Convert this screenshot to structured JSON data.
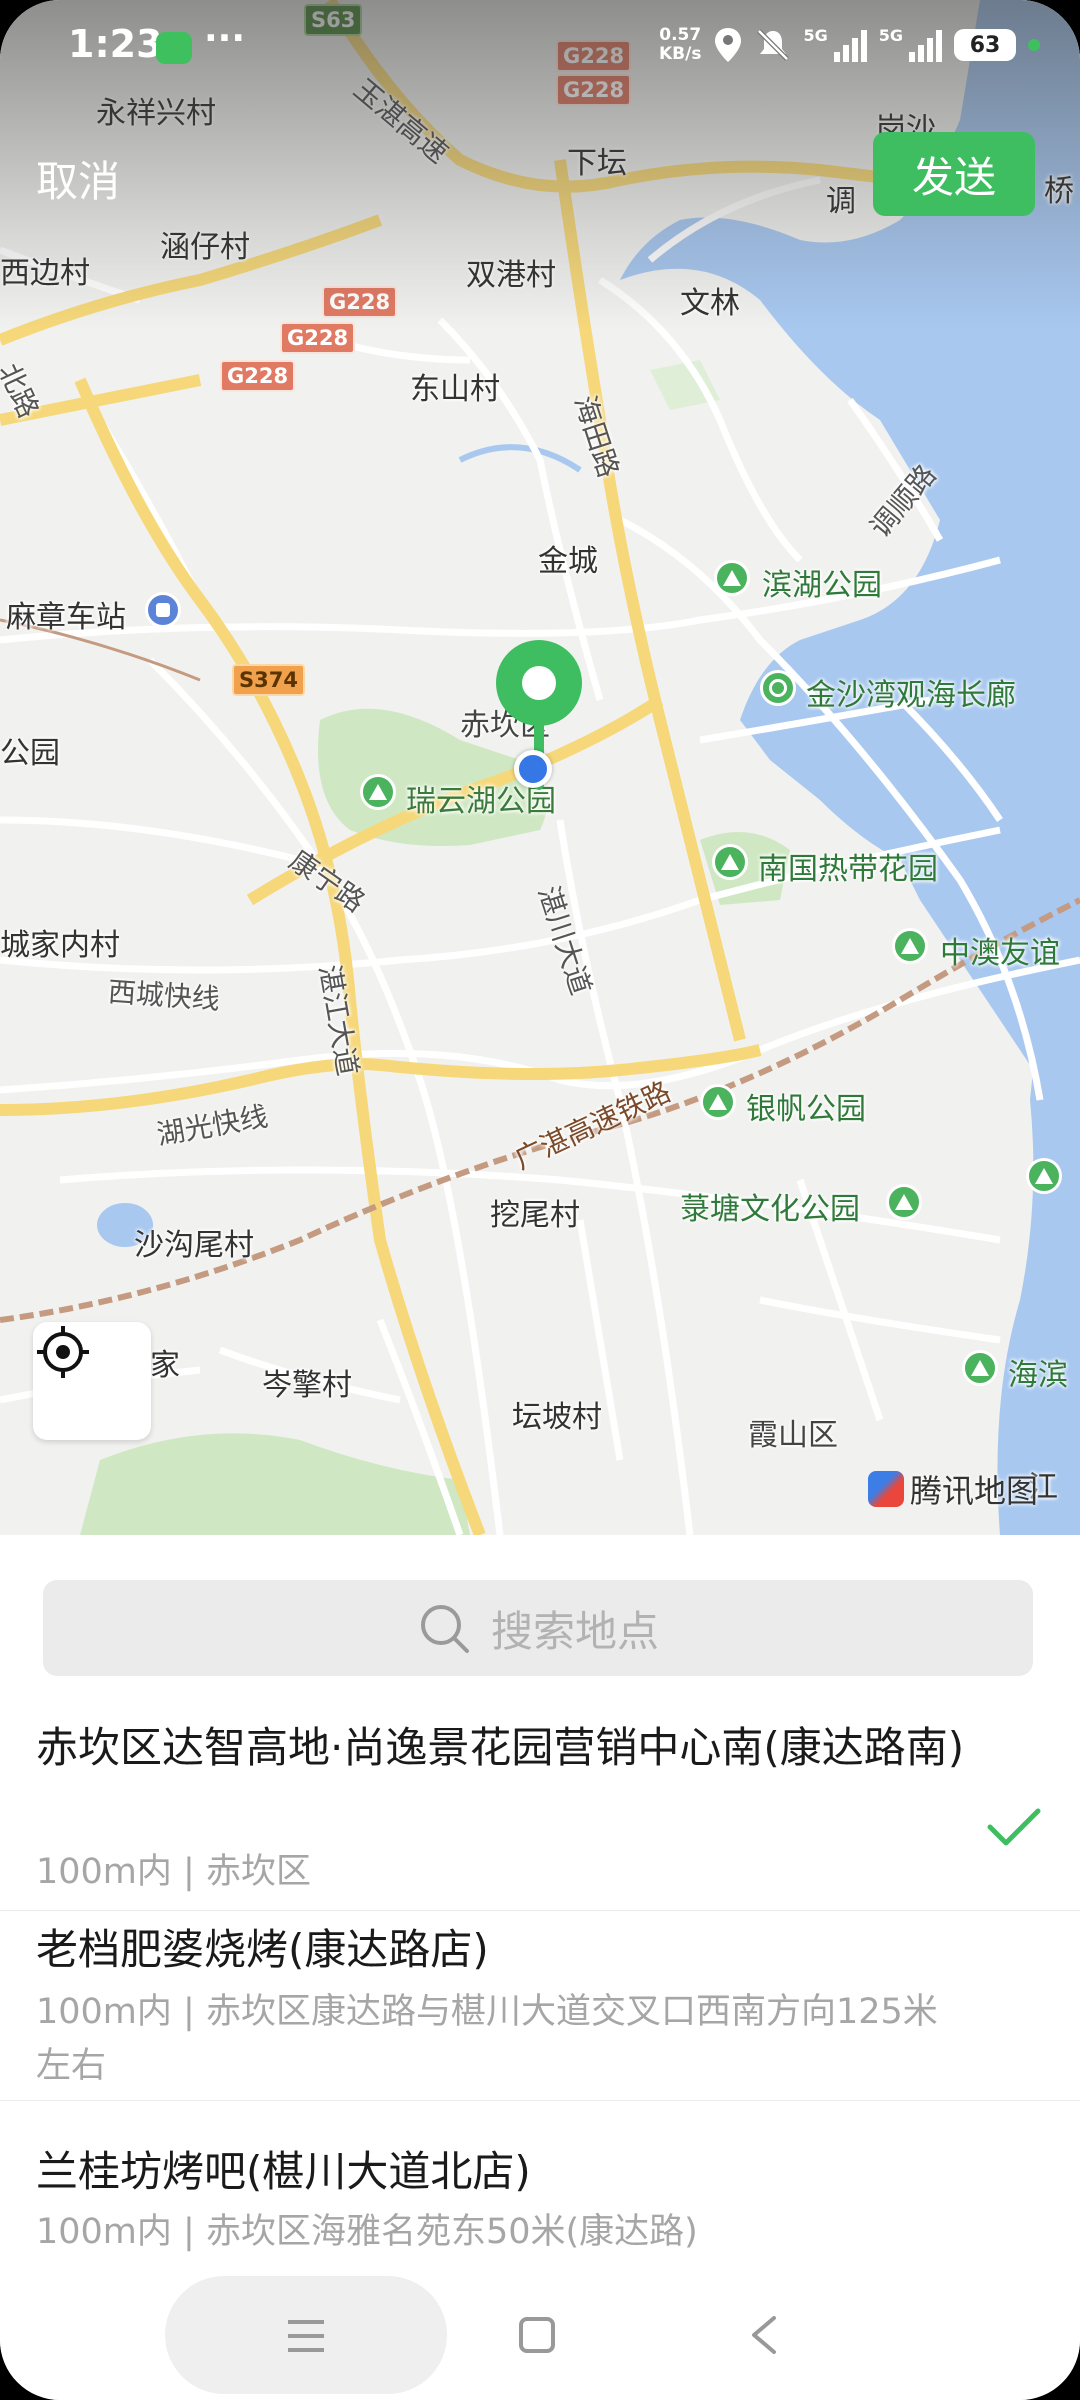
{
  "status_bar": {
    "time": "1:23",
    "more": "···",
    "net_speed_value": "0.57",
    "net_speed_unit": "KB/s",
    "network_1": "5G",
    "network_2": "5G",
    "battery": "63"
  },
  "header": {
    "cancel_label": "取消",
    "send_label": "发送"
  },
  "map": {
    "labels": {
      "yongxiangxing": "永祥兴村",
      "xiatan": "下坛",
      "gangsha": "岗沙",
      "tiao": "调",
      "qiao": "桥",
      "hanzai": "涵仔村",
      "shuanggang": "双港村",
      "wenlin": "文林",
      "bianbian": "西边村",
      "dongshan": "东山村",
      "haitian_road": "海田路",
      "tiaoshun_road": "调顺路",
      "jincheng": "金城",
      "xian_bei": "北路",
      "mazhang_station": "麻章车站",
      "chikan_district": "赤坎区",
      "ruiyunhu_park": "瑞云湖公园",
      "gongyuan_left": "公园",
      "kangning_road": "康宁路",
      "zhanchuan_road": "湛川大道",
      "chengjianei": "城家内村",
      "xicheng_express": "西城快线",
      "zhanjiang_road": "湛江大道",
      "huguang_express": "湖光快线",
      "guangzhan_rail": "广湛高速铁路",
      "wawei": "挖尾村",
      "shagouwei": "沙沟尾村",
      "cenqing": "岑擎村",
      "tanpo": "坛坡村",
      "xiashan": "霞山区",
      "binhu_park": "滨湖公园",
      "jinshawan": "金沙湾观海长廊",
      "nanguo_garden": "南国热带花园",
      "zhongao": "中澳友谊",
      "yinfan_park": "银帆公园",
      "caotang_park": "菉塘文化公园",
      "haibin": "海滨",
      "yugang_highway": "玉湛高速",
      "jiang": "江",
      "jia": "家"
    },
    "shields": {
      "s63": "S63",
      "g228_a": "G228",
      "g228_b": "G228",
      "g228_c": "G228",
      "g228_d": "G228",
      "g228_e": "G228",
      "s374": "S374"
    },
    "tencent_logo": "腾讯地图"
  },
  "search": {
    "placeholder": "搜索地点"
  },
  "results": [
    {
      "title": "赤坎区达智高地·尚逸景花园营销中心南(康达路南)",
      "subtitle": "100m内 | 赤坎区",
      "selected": true
    },
    {
      "title": "老档肥婆烧烤(康达路店)",
      "subtitle": "100m内 | 赤坎区康达路与椹川大道交叉口西南方向125米左右",
      "selected": false
    },
    {
      "title": "兰桂坊烤吧(椹川大道北店)",
      "subtitle": "100m内 | 赤坎区海雅名苑东50米(康达路)",
      "selected": false
    }
  ],
  "colors": {
    "accent_green": "#3fbe61",
    "location_blue": "#3578e5",
    "water": "#a8c8f0",
    "park": "#cfe8c3"
  },
  "icons": [
    "wechat-icon",
    "location-icon",
    "mute-icon",
    "signal-icon",
    "battery-icon",
    "map-pin-icon",
    "locate-icon",
    "search-icon",
    "check-icon",
    "menu-icon",
    "home-icon",
    "back-icon"
  ]
}
